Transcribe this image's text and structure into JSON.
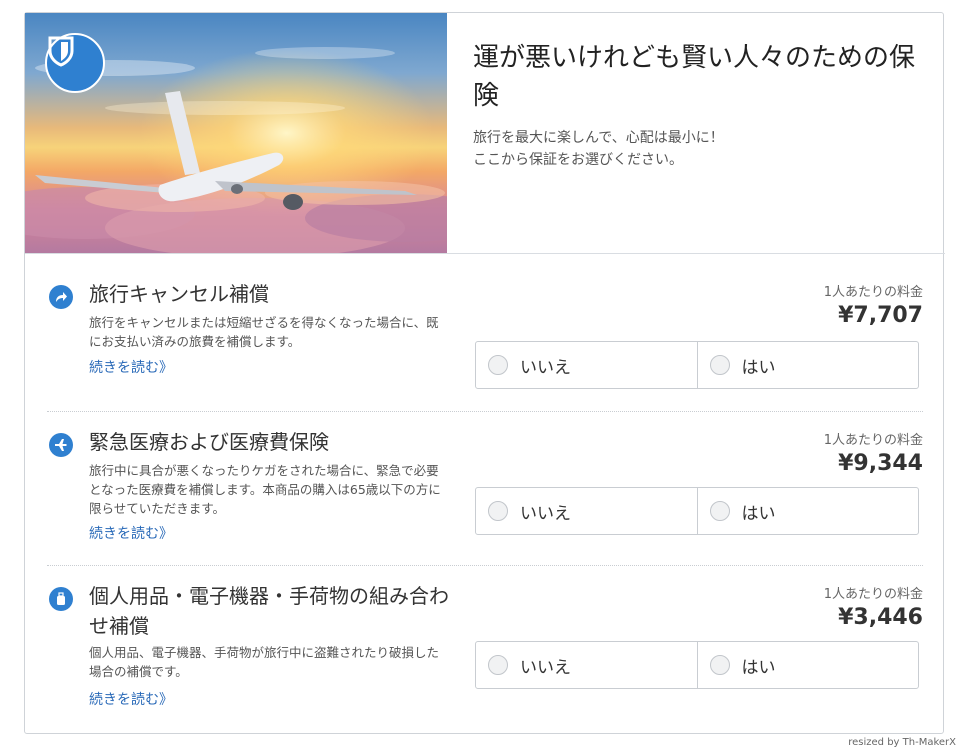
{
  "hero": {
    "title": "運が悪いけれども賢い人々のための保険",
    "subtitle": "旅行を最大に楽しんで、心配は最小に！\nここから保証をお選びください。",
    "badge_icon": "shield-icon",
    "image": "airplane-sunset-clouds"
  },
  "accent_color": "#2f80d0",
  "link_color": "#2a6ab8",
  "items": [
    {
      "icon": "share-arrow-icon",
      "title": "旅行キャンセル補償",
      "description": "旅行をキャンセルまたは短縮せざるを得なくなった場合に、既にお支払い済みの旅費を補償します。",
      "read_more": "続きを読む》",
      "price_label": "1人あたりの料金",
      "price": "¥7,707",
      "option_no": "いいえ",
      "option_yes": "はい"
    },
    {
      "icon": "airplane-icon",
      "title": "緊急医療および医療費保険",
      "description": "旅行中に具合が悪くなったりケガをされた場合に、緊急で必要となった医療費を補償します。本商品の購入は65歳以下の方に限らせていただきます。",
      "read_more": "続きを読む》",
      "price_label": "1人あたりの料金",
      "price": "¥9,344",
      "option_no": "いいえ",
      "option_yes": "はい"
    },
    {
      "icon": "luggage-icon",
      "title": "個人用品・電子機器・手荷物の組み合わせ補償",
      "description": "個人用品、電子機器、手荷物が旅行中に盗難されたり破損した場合の補償です。",
      "read_more": "続きを読む》",
      "price_label": "1人あたりの料金",
      "price": "¥3,446",
      "option_no": "いいえ",
      "option_yes": "はい"
    }
  ],
  "credit": "resized by Th-MakerX"
}
